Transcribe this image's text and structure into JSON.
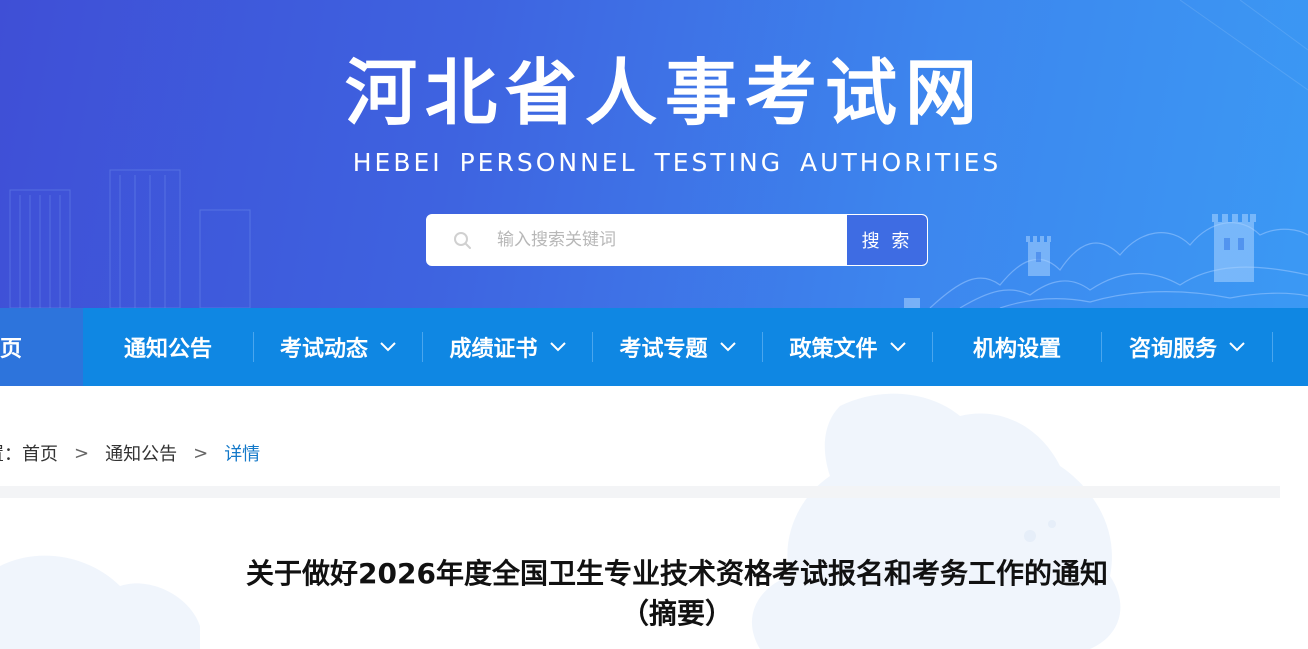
{
  "banner": {
    "title": "河北省人事考试网",
    "subtitle": "HEBEI PERSONNEL TESTING AUTHORITIES"
  },
  "search": {
    "placeholder": "输入搜索关键词",
    "value": "",
    "button_label": "搜 索"
  },
  "nav": {
    "items": [
      {
        "label": "页",
        "active": true,
        "has_dropdown": false
      },
      {
        "label": "通知公告",
        "active": false,
        "has_dropdown": false
      },
      {
        "label": "考试动态",
        "active": false,
        "has_dropdown": true
      },
      {
        "label": "成绩证书",
        "active": false,
        "has_dropdown": true
      },
      {
        "label": "考试专题",
        "active": false,
        "has_dropdown": true
      },
      {
        "label": "政策文件",
        "active": false,
        "has_dropdown": true
      },
      {
        "label": "机构设置",
        "active": false,
        "has_dropdown": false
      },
      {
        "label": "咨询服务",
        "active": false,
        "has_dropdown": true
      }
    ]
  },
  "breadcrumb": {
    "prefix": "置：",
    "items": [
      "首页",
      "通知公告"
    ],
    "separator": ">",
    "current": "详情"
  },
  "article": {
    "title_line1": "关于做好2026年度全国卫生专业技术资格考试报名和考务工作的通知",
    "title_line2": "（摘要）"
  },
  "colors": {
    "nav_bg": "#0f87e3",
    "nav_active": "#2d74dc",
    "breadcrumb_current": "#1479c9",
    "search_button": "#3e6ce3"
  }
}
